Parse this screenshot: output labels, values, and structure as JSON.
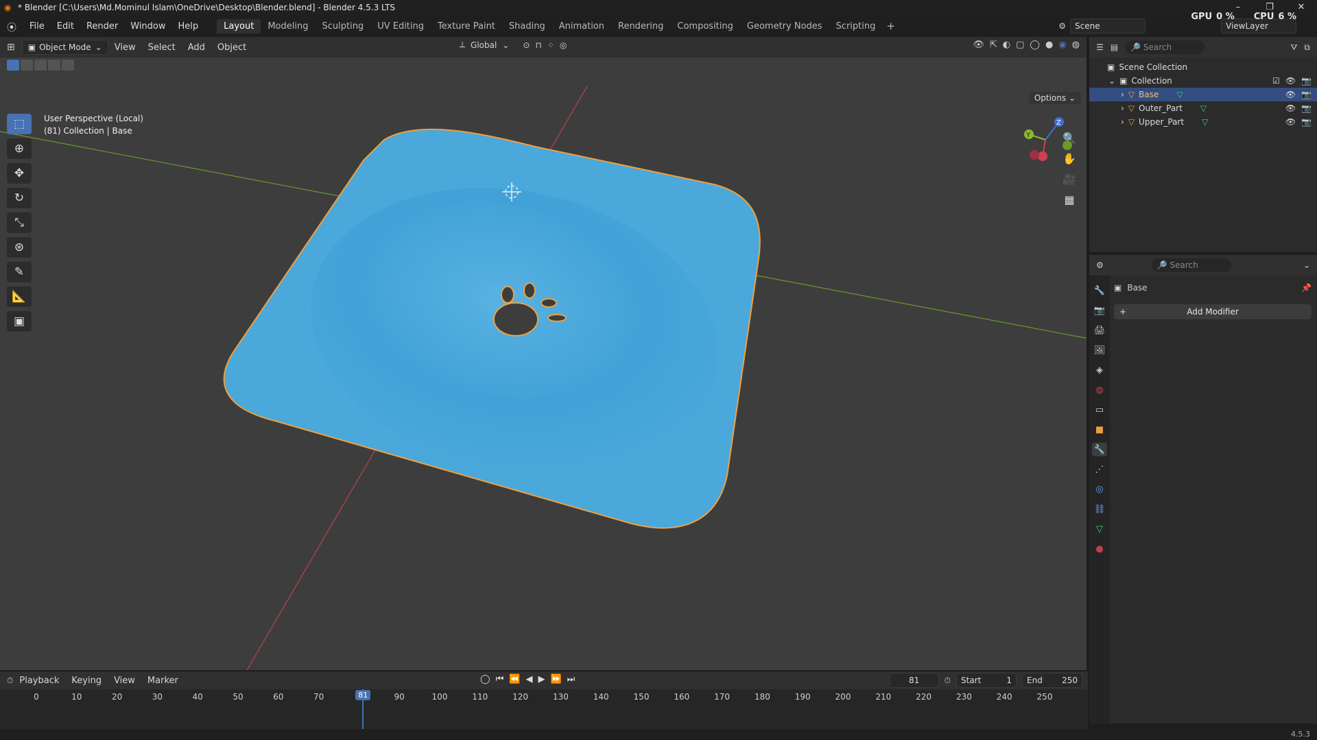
{
  "window": {
    "title": "* Blender [C:\\Users\\Md.Mominul Islam\\OneDrive\\Desktop\\Blender.blend] - Blender 4.5.3 LTS",
    "controls": [
      "–",
      "❐",
      "✕"
    ]
  },
  "menubar": {
    "menus": [
      "File",
      "Edit",
      "Render",
      "Window",
      "Help"
    ],
    "workspaces": [
      "Layout",
      "Modeling",
      "Sculpting",
      "UV Editing",
      "Texture Paint",
      "Shading",
      "Animation",
      "Rendering",
      "Compositing",
      "Geometry Nodes",
      "Scripting"
    ],
    "active_workspace": "Layout",
    "scene": "Scene",
    "view_layer": "ViewLayer",
    "gpu_label": "GPU",
    "gpu_value": "0 %",
    "cpu_label": "CPU",
    "cpu_value": "6 %"
  },
  "viewport": {
    "mode": "Object Mode",
    "menus": [
      "View",
      "Select",
      "Add",
      "Object"
    ],
    "orientation": "Global",
    "options_label": "Options",
    "info_line1": "User Perspective (Local)",
    "info_line2": "(81) Collection | Base",
    "axis_labels": {
      "x": "X",
      "y": "Y",
      "z": "Z"
    },
    "colors": {
      "object": "#4aa8da",
      "outline": "#f0a040",
      "x_axis": "#c0404a",
      "y_axis": "#6a9a2a",
      "background": "#3d3d3d"
    }
  },
  "outliner": {
    "search_placeholder": "Search",
    "root": "Scene Collection",
    "collection": "Collection",
    "items": [
      {
        "name": "Base",
        "selected": true
      },
      {
        "name": "Outer_Part",
        "selected": false
      },
      {
        "name": "Upper_Part",
        "selected": false
      }
    ]
  },
  "properties": {
    "search_placeholder": "Search",
    "object_name": "Base",
    "add_modifier": "Add Modifier"
  },
  "timeline": {
    "menus": [
      "Playback",
      "Keying",
      "View",
      "Marker"
    ],
    "current_frame": "81",
    "start_label": "Start",
    "start": "1",
    "end_label": "End",
    "end": "250",
    "ticks": [
      "0",
      "10",
      "20",
      "30",
      "40",
      "50",
      "60",
      "70",
      "90",
      "100",
      "110",
      "120",
      "130",
      "140",
      "150",
      "160",
      "170",
      "180",
      "190",
      "200",
      "210",
      "220",
      "230",
      "240",
      "250"
    ]
  },
  "status": {
    "version": "4.5.3"
  }
}
